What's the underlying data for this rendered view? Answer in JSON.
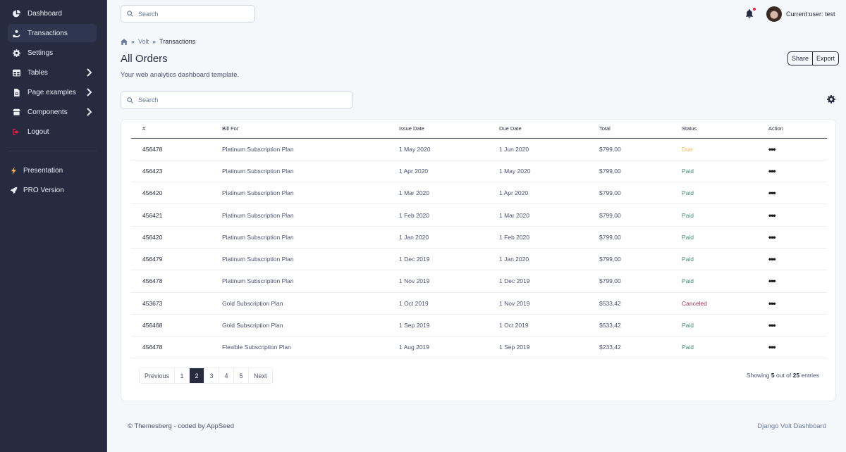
{
  "sidebar": {
    "items": [
      {
        "label": "Dashboard",
        "icon": "chart-pie-icon"
      },
      {
        "label": "Transactions",
        "icon": "hand-holding-usd-icon",
        "active": true
      },
      {
        "label": "Settings",
        "icon": "cog-icon"
      },
      {
        "label": "Tables",
        "icon": "table-icon",
        "has_submenu": true
      },
      {
        "label": "Page examples",
        "icon": "file-icon",
        "has_submenu": true
      },
      {
        "label": "Components",
        "icon": "box-open-icon",
        "has_submenu": true
      },
      {
        "label": "Logout",
        "icon": "sign-out-icon"
      }
    ],
    "secondary": [
      {
        "label": "Presentation",
        "icon": "bolt-icon"
      },
      {
        "label": "PRO Version",
        "icon": "rocket-icon"
      }
    ]
  },
  "topbar": {
    "search_placeholder": "Search",
    "user_label": "Current:user: test",
    "notification_icon": "bell-icon"
  },
  "breadcrumb": {
    "home_icon": "home-icon",
    "items": [
      "Volt",
      "Transactions"
    ]
  },
  "header": {
    "title": "All Orders",
    "subtitle": "Your web analytics dashboard template.",
    "share_label": "Share",
    "export_label": "Export"
  },
  "filter": {
    "search_placeholder": "Search",
    "settings_icon": "gear-icon"
  },
  "table": {
    "columns": [
      "#",
      "Bill For",
      "Issue Date",
      "Due Date",
      "Total",
      "Status",
      "Action"
    ],
    "rows": [
      {
        "id": "456478",
        "bill_for": "Platinum Subscription Plan",
        "issue_date": "1 May 2020",
        "due_date": "1 Jun 2020",
        "total": "$799,00",
        "status": "Due"
      },
      {
        "id": "456423",
        "bill_for": "Platinum Subscription Plan",
        "issue_date": "1 Apr 2020",
        "due_date": "1 May 2020",
        "total": "$799,00",
        "status": "Paid"
      },
      {
        "id": "456420",
        "bill_for": "Platinum Subscription Plan",
        "issue_date": "1 Mar 2020",
        "due_date": "1 Apr 2020",
        "total": "$799,00",
        "status": "Paid"
      },
      {
        "id": "456421",
        "bill_for": "Platinum Subscription Plan",
        "issue_date": "1 Feb 2020",
        "due_date": "1 Mar 2020",
        "total": "$799,00",
        "status": "Paid"
      },
      {
        "id": "456420",
        "bill_for": "Platinum Subscription Plan",
        "issue_date": "1 Jan 2020",
        "due_date": "1 Feb 2020",
        "total": "$799,00",
        "status": "Paid"
      },
      {
        "id": "456479",
        "bill_for": "Platinum Subscription Plan",
        "issue_date": "1 Dec 2019",
        "due_date": "1 Jan 2020",
        "total": "$799,00",
        "status": "Paid"
      },
      {
        "id": "456478",
        "bill_for": "Platinum Subscription Plan",
        "issue_date": "1 Nov 2019",
        "due_date": "1 Dec 2019",
        "total": "$799,00",
        "status": "Paid"
      },
      {
        "id": "453673",
        "bill_for": "Gold Subscription Plan",
        "issue_date": "1 Oct 2019",
        "due_date": "1 Nov 2019",
        "total": "$533,42",
        "status": "Canceled"
      },
      {
        "id": "456468",
        "bill_for": "Gold Subscription Plan",
        "issue_date": "1 Sep 2019",
        "due_date": "1 Oct 2019",
        "total": "$533,42",
        "status": "Paid"
      },
      {
        "id": "456478",
        "bill_for": "Flexible Subscription Plan",
        "issue_date": "1 Aug 2019",
        "due_date": "1 Sep 2019",
        "total": "$233,42",
        "status": "Paid"
      }
    ],
    "action_icon": "ellipsis-icon"
  },
  "pagination": {
    "previous_label": "Previous",
    "next_label": "Next",
    "pages": [
      "1",
      "2",
      "3",
      "4",
      "5"
    ],
    "current_page": "2",
    "showing_prefix": "Showing",
    "showing_count": "5",
    "showing_middle": "out of",
    "showing_total": "25",
    "showing_suffix": "entries"
  },
  "footer": {
    "left": "© Themesberg - coded by AppSeed",
    "right": "Django Volt Dashboard"
  },
  "colors": {
    "sidebar_bg": "#262b40",
    "sidebar_active": "#2e3650",
    "page_bg": "#f5f8fb",
    "status_due": "#f5b759",
    "status_paid": "#10b981",
    "status_canceled": "#e11d48",
    "notification_dot": "#e11d48"
  }
}
